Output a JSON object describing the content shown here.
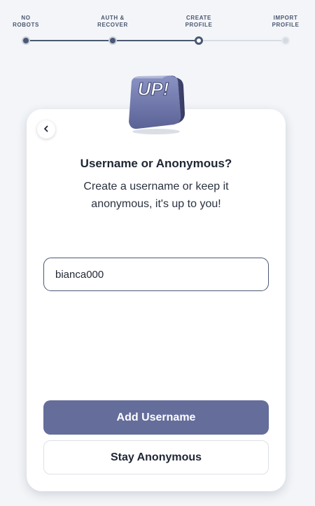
{
  "stepper": {
    "steps": [
      {
        "label": "NO\nROBOTS",
        "state": "done"
      },
      {
        "label": "AUTH &\nRECOVER",
        "state": "done"
      },
      {
        "label": "CREATE\nPROFILE",
        "state": "current"
      },
      {
        "label": "IMPORT\nPROFILE",
        "state": "todo"
      }
    ]
  },
  "logo": {
    "text": "UP!"
  },
  "card": {
    "title": "Username or Anonymous?",
    "subtitle": "Create a username or keep it anonymous, it's up to you!",
    "username_input": {
      "value": "bianca000",
      "placeholder": ""
    },
    "primary_button": "Add Username",
    "secondary_button": "Stay Anonymous"
  },
  "colors": {
    "accent": "#656d9b",
    "stepper_active": "#4b5874",
    "background": "#f3f5f8"
  }
}
